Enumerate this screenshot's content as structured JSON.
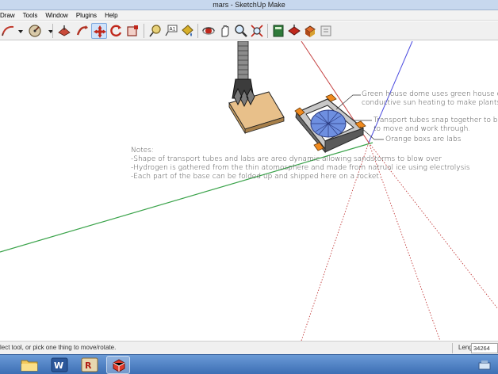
{
  "window": {
    "title": "mars - SketchUp Make"
  },
  "menu": {
    "items": [
      "Draw",
      "Tools",
      "Window",
      "Plugins",
      "Help"
    ]
  },
  "toolbar": {
    "tools": [
      {
        "name": "arc-tool-icon"
      },
      {
        "name": "paint-bucket-icon"
      },
      {
        "name": "push-pull-icon"
      },
      {
        "name": "rotate-icon"
      },
      {
        "name": "move-icon"
      },
      {
        "name": "follow-me-icon"
      },
      {
        "name": "scale-icon"
      },
      {
        "name": "tape-measure-icon"
      },
      {
        "name": "text-tool-icon"
      },
      {
        "name": "paint-icon"
      },
      {
        "name": "orbit-icon"
      },
      {
        "name": "pan-icon"
      },
      {
        "name": "zoom-icon"
      },
      {
        "name": "zoom-extents-icon"
      },
      {
        "name": "warehouse-icon"
      },
      {
        "name": "share-model-icon"
      },
      {
        "name": "components-icon"
      },
      {
        "name": "extension-icon"
      }
    ],
    "active_tool": "move-icon"
  },
  "canvas": {
    "annotations": {
      "dome": [
        "Green house dome uses green house ef",
        "conductive sun heating to make plants a"
      ],
      "tubes": [
        "Transport tubes snap together to be",
        "to move and work through."
      ],
      "labs": "Orange boxs are labs"
    },
    "notes": [
      "Notes:",
      "-Shape of transport tubes and labs are areo dynamic allowing sandstorms to blow over",
      "-Hydrogen is gathered from the thin atomosphere and made from natrual ice using electrolysis",
      "-Each part of the base can be folded up and shipped here on a rocket."
    ]
  },
  "statusbar": {
    "message": "lect tool, or pick one thing to move/rotate.",
    "length_label": "Length",
    "length_value": "34264"
  },
  "taskbar": {
    "apps": [
      "file-explorer-icon",
      "word-icon",
      "revit-icon",
      "sketchup-icon"
    ],
    "active_app": "sketchup-icon"
  },
  "colors": {
    "title_bar": "#c7d8ee",
    "green_axis": "#3aa34a",
    "red_axis": "#c44040",
    "blue_axis": "#4a4ae0",
    "dome_blue": "#6e8fe0",
    "lab_orange": "#f08a1e",
    "base_tan": "#e8c08a"
  }
}
